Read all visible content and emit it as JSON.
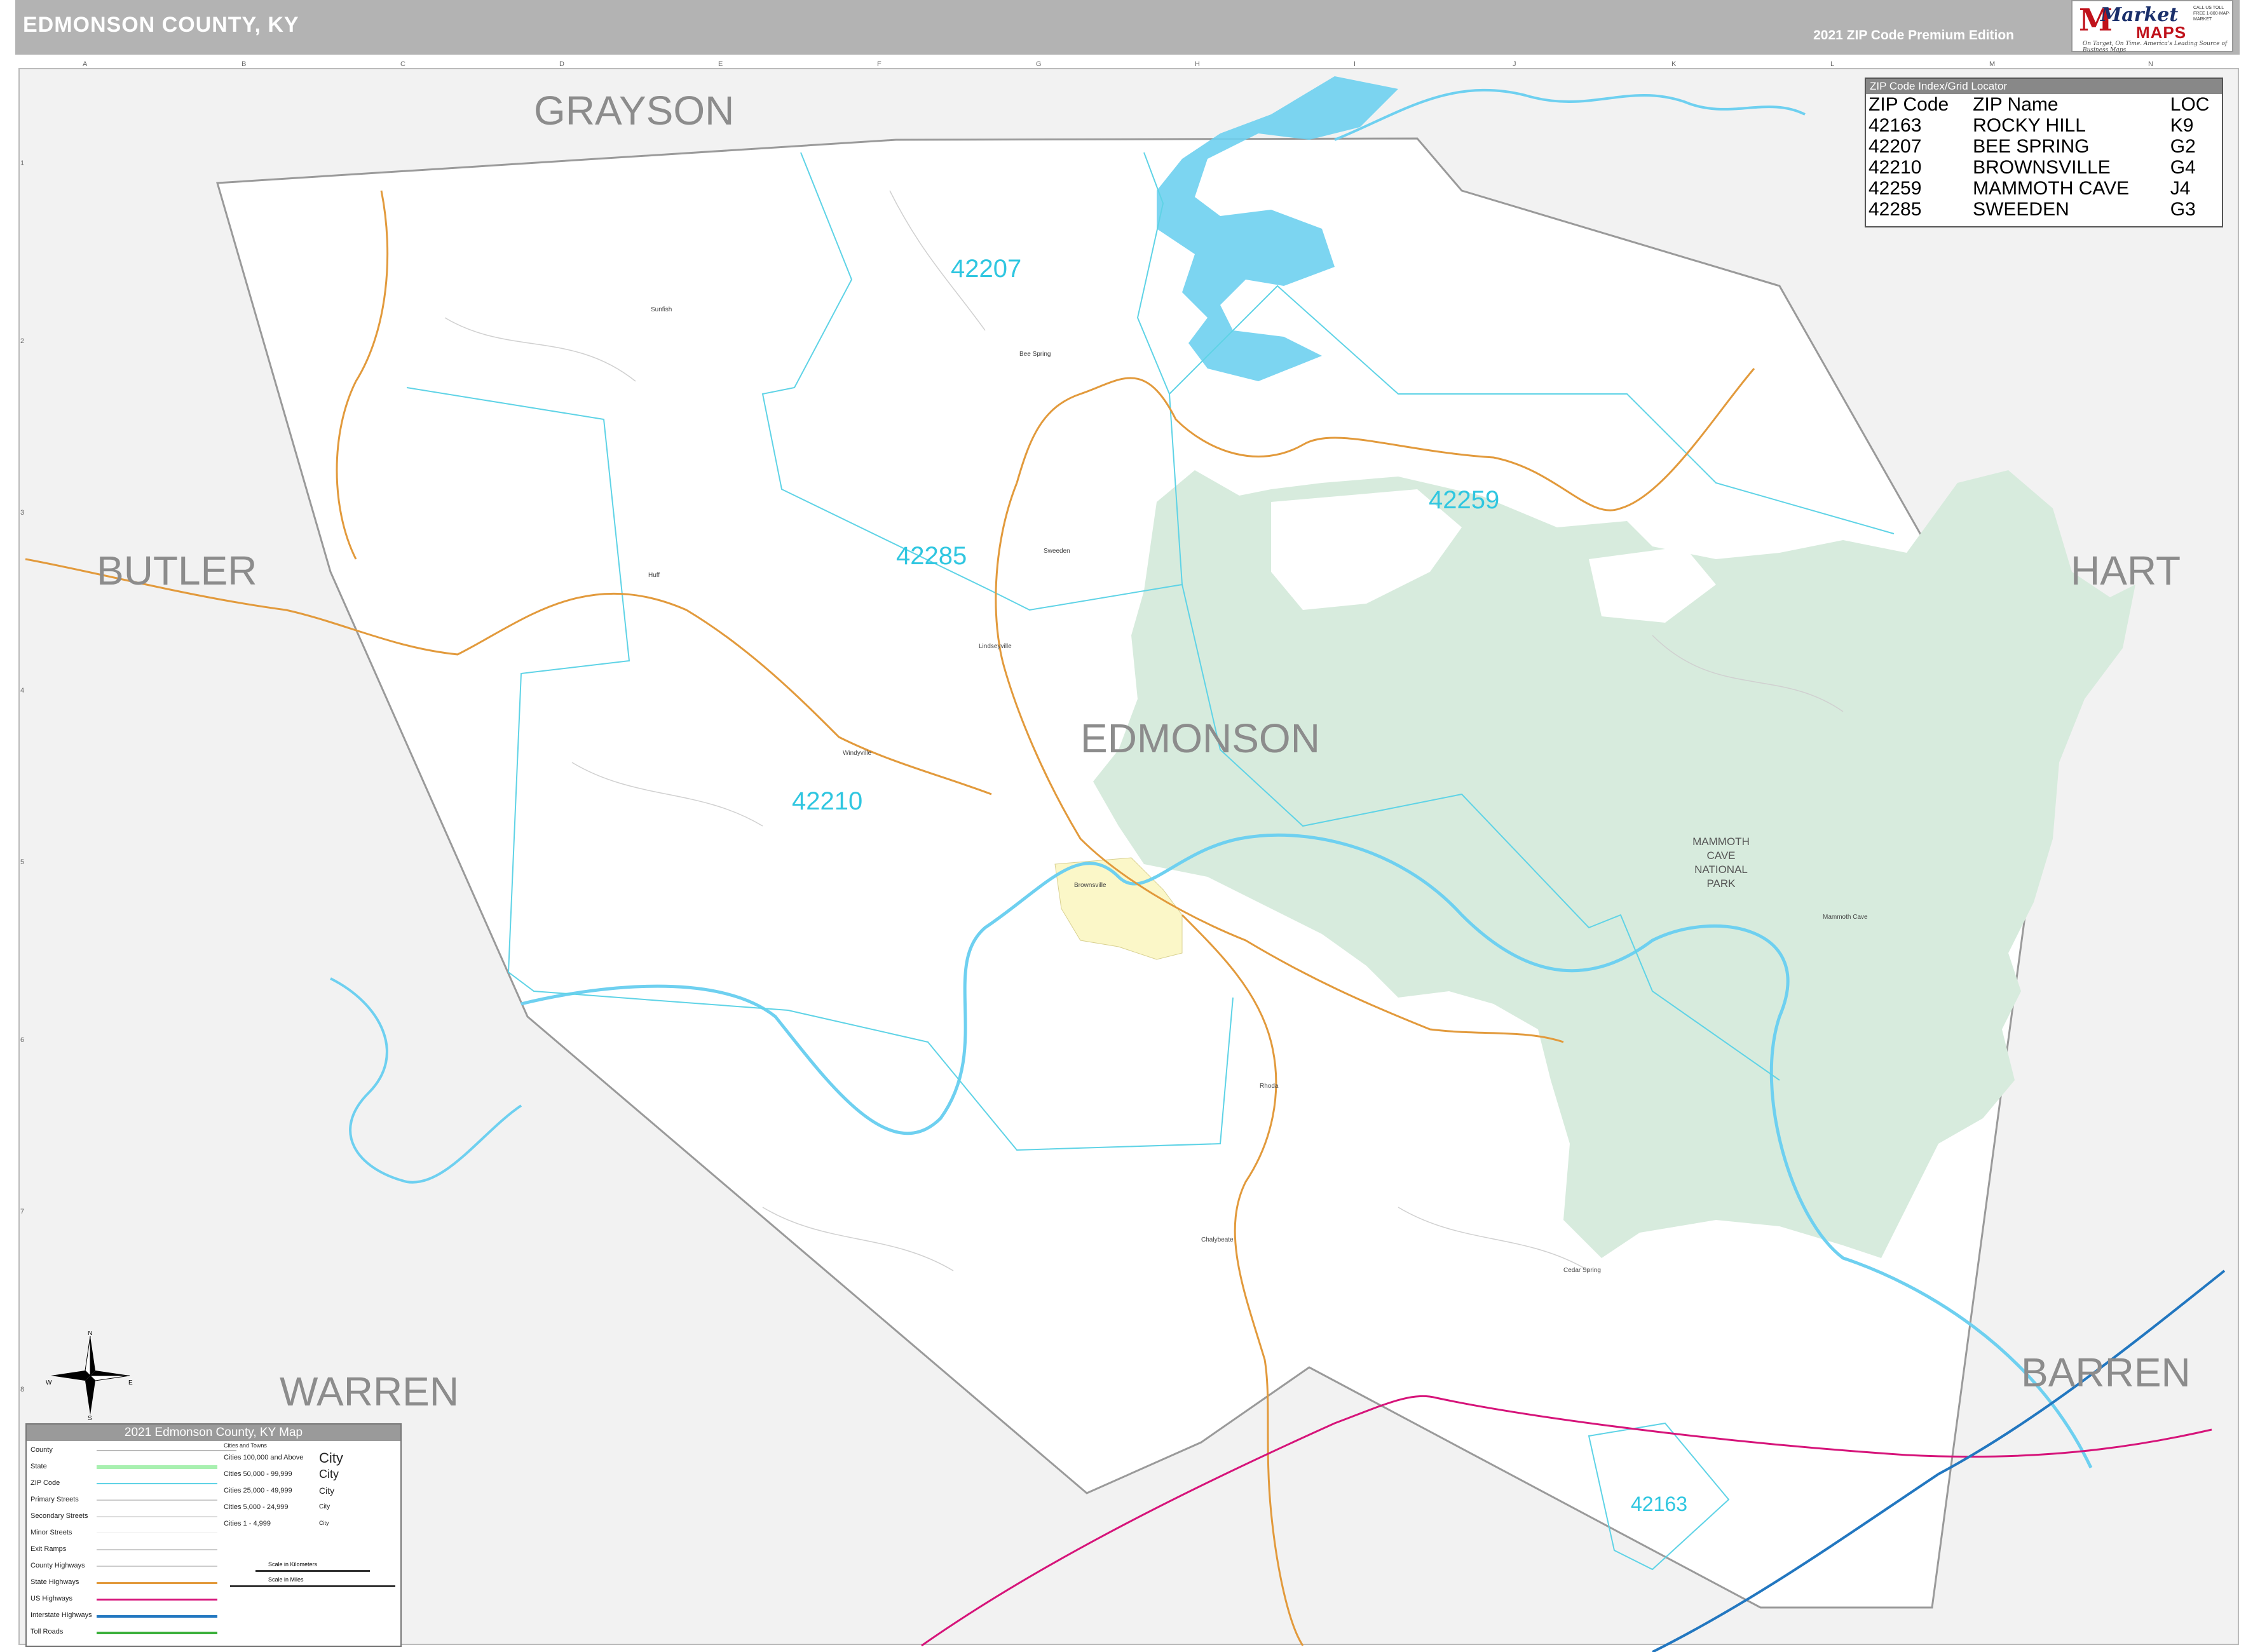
{
  "header": {
    "title": "EDMONSON COUNTY, KY",
    "edition": "2021 ZIP Code Premium Edition"
  },
  "logo": {
    "market": "Market",
    "maps": "MAPS",
    "tagline": "On Target, On Time. America's Leading Source of Business Maps",
    "phone": "CALL US TOLL FREE 1-800-MAP-MARKET"
  },
  "grid": {
    "columns": [
      "A",
      "B",
      "C",
      "D",
      "E",
      "F",
      "G",
      "H",
      "I",
      "J",
      "K",
      "L",
      "M",
      "N"
    ],
    "rows": [
      "1",
      "2",
      "3",
      "4",
      "5",
      "6",
      "7",
      "8"
    ]
  },
  "counties": {
    "grayson": "GRAYSON",
    "butler": "BUTLER",
    "hart": "HART",
    "edmonson": "EDMONSON",
    "warren": "WARREN",
    "barren": "BARREN"
  },
  "zip_labels": {
    "z42207": "42207",
    "z42259": "42259",
    "z42285": "42285",
    "z42210": "42210",
    "z42163": "42163"
  },
  "park": {
    "name_line1": "MAMMOTH",
    "name_line2": "CAVE",
    "name_line3": "NATIONAL",
    "name_line4": "PARK"
  },
  "towns": {
    "bee_spring": "Bee Spring",
    "sweeden": "Sweeden",
    "brownsville": "Brownsville",
    "mammoth_cave": "Mammoth Cave",
    "chalybeate": "Chalybeate",
    "cedar_spring": "Cedar Spring",
    "lindseyville": "Lindseyville",
    "windyville": "Windyville",
    "huff": "Huff",
    "sunfish": "Sunfish",
    "rhoda": "Rhoda"
  },
  "zip_index": {
    "title": "ZIP Code Index/Grid Locator",
    "headers": [
      "ZIP Code",
      "ZIP Name",
      "LOC"
    ],
    "rows": [
      [
        "42163",
        "ROCKY HILL",
        "K9"
      ],
      [
        "42207",
        "BEE SPRING",
        "G2"
      ],
      [
        "42210",
        "BROWNSVILLE",
        "G4"
      ],
      [
        "42259",
        "MAMMOTH CAVE",
        "J4"
      ],
      [
        "42285",
        "SWEEDEN",
        "G3"
      ]
    ]
  },
  "legend": {
    "title": "2021 Edmonson County, KY Map",
    "items": [
      "County",
      "State",
      "ZIP Code",
      "Primary Streets",
      "Secondary Streets",
      "Minor Streets",
      "Exit Ramps",
      "County Highways",
      "State Highways",
      "US Highways",
      "Interstate Highways",
      "Toll Roads"
    ],
    "cities_header": "Cities and Towns",
    "city_classes": [
      "Cities 100,000 and Above",
      "Cities 50,000 - 99,999",
      "Cities 25,000 - 49,999",
      "Cities 5,000 - 24,999",
      "Cities 1 - 4,999"
    ],
    "city_samples": [
      "City",
      "City",
      "City",
      "City",
      "City"
    ],
    "scale_km": "Scale in Kilometers",
    "scale_mi": "Scale in Miles"
  },
  "compass": {
    "n": "N",
    "s": "S",
    "e": "E",
    "w": "W"
  },
  "colors": {
    "county_fill": "#ffffff",
    "outside_fill": "#f2f2f2",
    "park_fill": "#d7ebdd",
    "water": "#6ed0f0",
    "zip_line": "#5fd3e6",
    "zip_label": "#2fc6e0",
    "state_hwy": "#e29a3c",
    "us_hwy": "#d6147a",
    "interstate": "#2277c0",
    "city_fill": "#fbf7c8",
    "county_line": "#9a9a9a",
    "county_label": "#8c8c8c"
  }
}
